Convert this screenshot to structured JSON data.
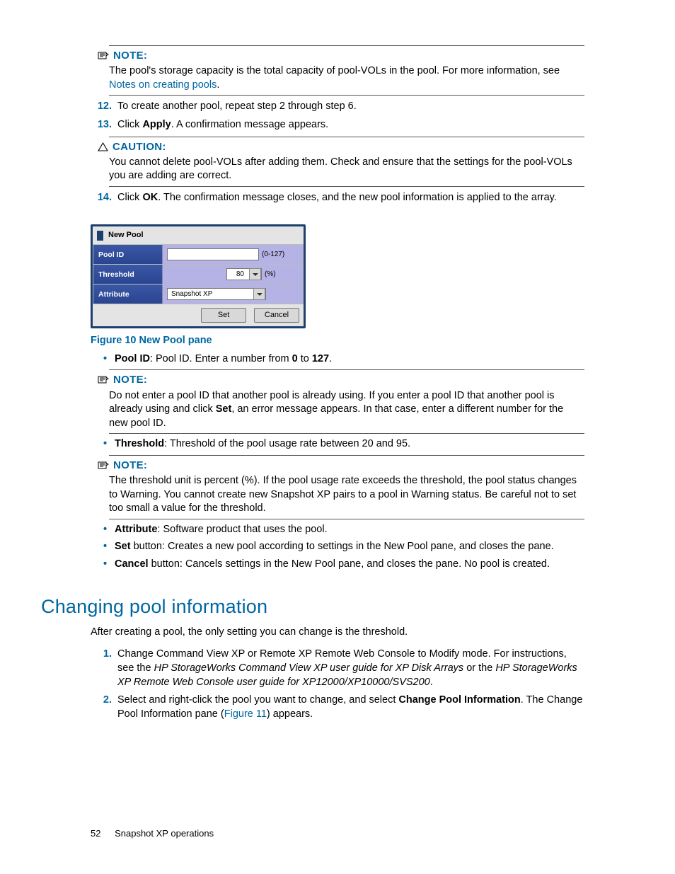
{
  "note1": {
    "label": "NOTE:",
    "text_a": "The pool's storage capacity is the total capacity of pool-VOLs in the pool. For more information, see ",
    "link": "Notes on creating pools",
    "text_b": "."
  },
  "steps_a": [
    {
      "num": "12.",
      "text": "To create another pool, repeat step 2 through step 6."
    },
    {
      "num": "13.",
      "pre": "Click ",
      "bold": "Apply",
      "post": ". A confirmation message appears."
    }
  ],
  "caution": {
    "label": "CAUTION:",
    "text": "You cannot delete pool-VOLs after adding them. Check and ensure that the settings for the pool-VOLs you are adding are correct."
  },
  "step14": {
    "num": "14.",
    "pre": "Click ",
    "bold": "OK",
    "post": ". The confirmation message closes, and the new pool information is applied to the array."
  },
  "new_pool_pane": {
    "title": "New Pool",
    "rows": {
      "poolid_label": "Pool ID",
      "poolid_hint": "(0-127)",
      "threshold_label": "Threshold",
      "threshold_value": "80",
      "threshold_unit": "(%)",
      "attribute_label": "Attribute",
      "attribute_value": "Snapshot XP"
    },
    "set": "Set",
    "cancel": "Cancel"
  },
  "figure_caption": "Figure 10 New Pool pane",
  "bullets1": {
    "poolid": {
      "name": "Pool ID",
      "text": ": Pool ID. Enter a number from ",
      "b1": "0",
      "mid": " to ",
      "b2": "127",
      "end": "."
    }
  },
  "note2": {
    "label": "NOTE:",
    "text_a": "Do not enter a pool ID that another pool is already using. If you enter a pool ID that another pool is already using and click ",
    "bold": "Set",
    "text_b": ", an error message appears. In that case, enter a different number for the new pool ID."
  },
  "bullets2": {
    "threshold": {
      "name": "Threshold",
      "text": ": Threshold of the pool usage rate between 20 and 95."
    }
  },
  "note3": {
    "label": "NOTE:",
    "text": "The threshold unit is percent (%). If the pool usage rate exceeds the threshold, the pool status changes to Warning. You cannot create new Snapshot XP pairs to a pool in Warning status. Be careful not to set too small a value for the threshold."
  },
  "bullets3": [
    {
      "name": "Attribute",
      "text": ": Software product that uses the pool."
    },
    {
      "name": "Set",
      "text": " button: Creates a new pool according to settings in the New Pool pane, and closes the pane."
    },
    {
      "name": "Cancel",
      "text": " button: Cancels settings in the New Pool pane, and closes the pane. No pool is created."
    }
  ],
  "section_heading": "Changing pool information",
  "section_intro": "After creating a pool, the only setting you can change is the threshold.",
  "steps_b": {
    "s1": {
      "num": "1.",
      "t1": "Change Command View XP or Remote XP Remote Web Console to Modify mode. For instructions, see the ",
      "i1": "HP StorageWorks Command View XP user guide for XP Disk Arrays",
      "t2": " or the ",
      "i2": "HP StorageWorks XP Remote Web Console user guide for XP12000/XP10000/SVS200",
      "t3": "."
    },
    "s2": {
      "num": "2.",
      "t1": "Select and right-click the pool you want to change, and select ",
      "b1": "Change Pool Information",
      "t2": ". The Change Pool Information pane (",
      "link": "Figure 11",
      "t3": ") appears."
    }
  },
  "footer": {
    "page": "52",
    "chapter": "Snapshot XP operations"
  }
}
